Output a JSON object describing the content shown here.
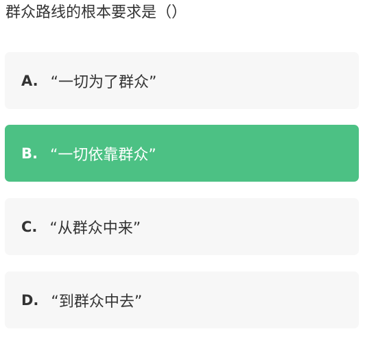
{
  "question": {
    "text": "群众路线的根本要求是（）"
  },
  "options": [
    {
      "letter": "A.",
      "text": "“一切为了群众”",
      "selected": false
    },
    {
      "letter": "B.",
      "text": "“一切依靠群众”",
      "selected": true
    },
    {
      "letter": "C.",
      "text": "“从群众中来”",
      "selected": false
    },
    {
      "letter": "D.",
      "text": "“到群众中去”",
      "selected": false
    }
  ],
  "colors": {
    "selected_background": "#4cc184",
    "option_background": "#f7f7f7",
    "text": "#333333",
    "selected_text": "#ffffff"
  }
}
